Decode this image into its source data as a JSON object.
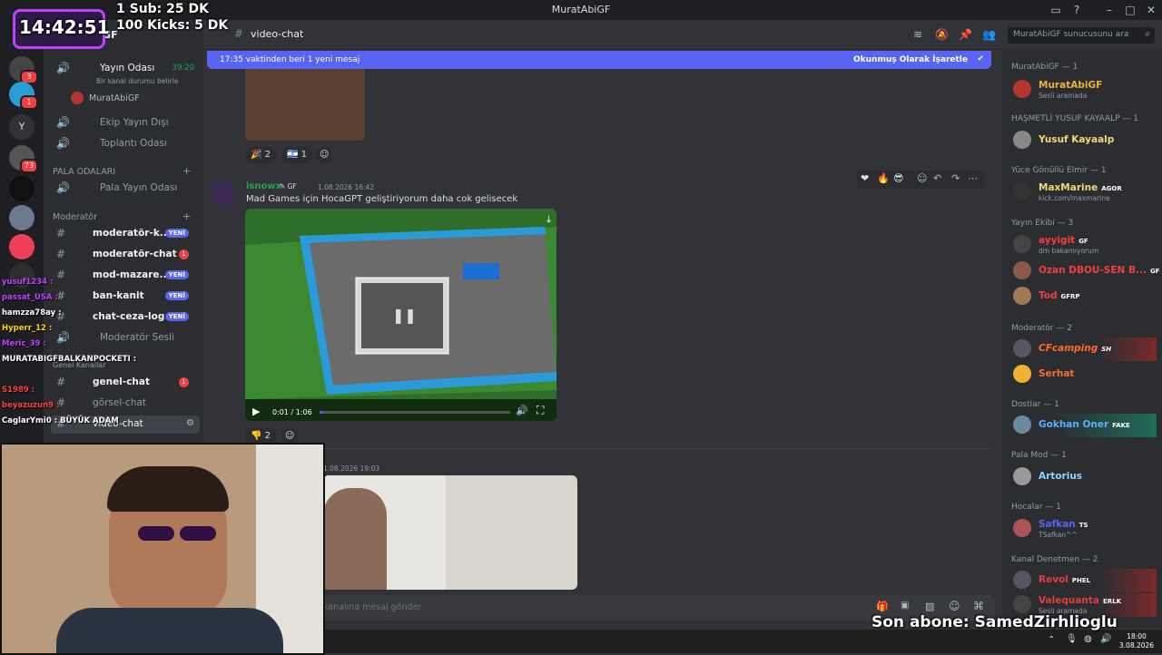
{
  "window": {
    "title": "MuratAbiGF"
  },
  "stream_overlay": {
    "clock": "14:42:51",
    "goals": [
      "1 Sub: 25 DK",
      "100 Kicks: 5 DK"
    ],
    "last_sub": "Son abone: SamedZirhlioglu",
    "chat": [
      {
        "user": "yusuf1234",
        "text": ":",
        "color": "#c040ff"
      },
      {
        "user": "passat_USA",
        "text": ":",
        "color": "#c040ff"
      },
      {
        "user": "hamzza78ay",
        "text": ":",
        "color": "#ffffff"
      },
      {
        "user": "Hyperr_12",
        "text": ":",
        "color": "#ffd800"
      },
      {
        "user": "Meric_39",
        "text": ":",
        "color": "#c040ff"
      },
      {
        "user": "MURATABIGFBALKANPOCKETI",
        "text": ":",
        "color": "#ffffff"
      },
      {
        "user": "S1989",
        "text": ":",
        "color": "#ff4040"
      },
      {
        "user": "beyazuzun9",
        "text": ":",
        "color": "#ff4040"
      },
      {
        "user": "CaglarYmi0",
        "text": ": BÜYÜK ADAM",
        "color": "#ffffff"
      }
    ]
  },
  "server": {
    "name": "MuratAbiGF"
  },
  "rail": {
    "badges": [
      "3",
      "1",
      "73"
    ],
    "letter": "Y"
  },
  "channels": {
    "voice_top": {
      "label": "Yayın Odası",
      "timer": "39:20",
      "status": "Bir kanal durumu belirle",
      "user": "MuratAbiGF"
    },
    "voice": [
      {
        "label": "Ekip Yayın Dışı"
      },
      {
        "label": "Toplantı Odası"
      }
    ],
    "pala_cat": "PALA ODALARI",
    "pala_items": [
      {
        "label": "Pala Yayın Odası"
      }
    ],
    "mod_cat": "Moderatör",
    "mod_items": [
      {
        "label": "moderatör-k...",
        "badge": "YENİ"
      },
      {
        "label": "moderatör-chat",
        "badge": "1"
      },
      {
        "label": "mod-mazare...",
        "badge": "YENİ"
      },
      {
        "label": "ban-kanit",
        "badge": "YENİ"
      },
      {
        "label": "chat-ceza-log",
        "badge": "YENİ"
      },
      {
        "label": "Moderatör Sesli",
        "badge": ""
      }
    ],
    "genel_cat": "Genel Kanallar",
    "genel_items": [
      {
        "label": "genel-chat",
        "badge": "1"
      },
      {
        "label": "görsel-chat",
        "badge": ""
      },
      {
        "label": "video-chat",
        "badge": ""
      }
    ]
  },
  "header": {
    "channel": "video-chat",
    "search_placeholder": "MuratAbiGF sunucusunu ara"
  },
  "new_messages": {
    "text": "17:35 vaktinden beri 1 yeni mesaj",
    "action": "Okunmuş Olarak İşaretle"
  },
  "messages": {
    "first_reactions": [
      {
        "emoji": "🎉",
        "count": "2"
      },
      {
        "emoji": "🇮🇱",
        "count": "1"
      }
    ],
    "post": {
      "author": "isnowx",
      "tag": "GF",
      "time": "1.08.2026 16:42",
      "text": "Mad Games için HocaGPT geliştiriyorum daha cok gelisecek",
      "video_time": "0:01 / 1:06",
      "progress": 0.02,
      "reaction": {
        "emoji": "👎",
        "count": "2"
      }
    },
    "second": {
      "time": "1.08.2026 19:03"
    }
  },
  "composer": {
    "placeholder": "#video-chat kanalına mesaj gönder",
    "visible_text": "kanalına mesaj gönder"
  },
  "members": {
    "groups": [
      {
        "title": "MuratAbiGF — 1",
        "members": [
          {
            "name": "MuratAbiGF",
            "status": "Sesli aramada",
            "color": "#f0b232",
            "tag": ""
          }
        ]
      },
      {
        "title": "HAŞMETLİ YUSUF KAYAALP — 1",
        "members": [
          {
            "name": "Yusuf Kayaalp",
            "status": "",
            "color": "#f0d77a",
            "tag": ""
          }
        ]
      },
      {
        "title": "Yüce Gönüllü Elmir — 1",
        "members": [
          {
            "name": "MaxMarine",
            "status": "kick.com/maxmarine",
            "color": "#f0d77a",
            "tag": "AGOR"
          }
        ]
      },
      {
        "title": "Yayın Ekibi — 3",
        "members": [
          {
            "name": "ayyigit",
            "status": "dm bakamıyorum",
            "color": "#f23f43",
            "tag": "GF"
          },
          {
            "name": "Ozan DBOU-SEN B...",
            "status": "",
            "color": "#f23f43",
            "tag": "GF"
          },
          {
            "name": "Tod",
            "status": "",
            "color": "#f23f43",
            "tag": "GFRP"
          }
        ]
      },
      {
        "title": "Moderatör — 2",
        "members": [
          {
            "name": "CFcamping",
            "status": "",
            "color": "#ff6b2b",
            "tag": "SH"
          },
          {
            "name": "Serhat",
            "status": "",
            "color": "#ff6b2b",
            "tag": ""
          }
        ]
      },
      {
        "title": "Dostlar — 1",
        "members": [
          {
            "name": "Gokhan Oner",
            "status": "",
            "color": "#5ab0ff",
            "tag": "FAKE"
          }
        ]
      },
      {
        "title": "Pala Mod — 1",
        "members": [
          {
            "name": "Artorius",
            "status": "",
            "color": "#8fd3ff",
            "tag": ""
          }
        ]
      },
      {
        "title": "Hocalar — 1",
        "members": [
          {
            "name": "Safkan",
            "status": "TSafkan^^",
            "color": "#5865f2",
            "tag": "TS"
          }
        ]
      },
      {
        "title": "Kanal Denetmen — 2",
        "members": [
          {
            "name": "Revol",
            "status": "",
            "color": "#e03e3e",
            "tag": "PHEL"
          },
          {
            "name": "Valequanta",
            "status": "Sesli aramada",
            "color": "#e03e3e",
            "tag": "ERLK"
          }
        ]
      }
    ]
  },
  "taskbar": {
    "time": "18:00",
    "date": "3.08.2026"
  }
}
